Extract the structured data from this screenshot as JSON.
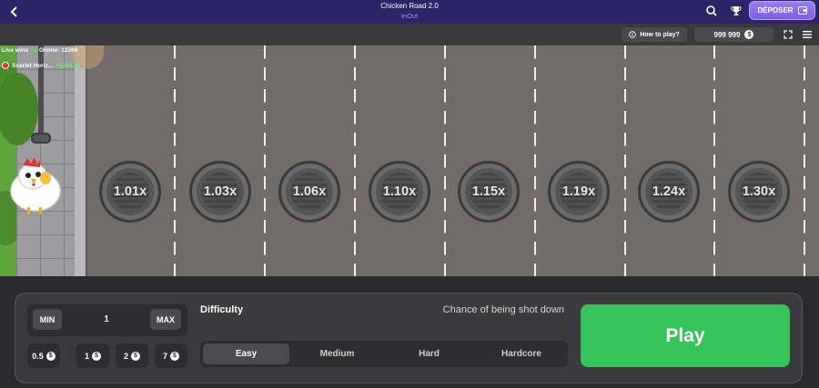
{
  "header": {
    "title": "Chicken Road 2.0",
    "subtitle": "InOut",
    "deposit_label": "DÉPOSER"
  },
  "toolbar": {
    "how_to_play": "How to play?",
    "balance": "999 999",
    "coin_symbol": "$"
  },
  "live": {
    "live_wins_label": "Live wins",
    "online_label": "Online: 12269",
    "winner_name": "Scarlet Horiz...",
    "winner_amount": "+$265.10"
  },
  "multipliers": [
    "1.01x",
    "1.03x",
    "1.06x",
    "1.10x",
    "1.15x",
    "1.19x",
    "1.24x",
    "1.30x"
  ],
  "bet": {
    "min_label": "MIN",
    "max_label": "MAX",
    "value": "1",
    "chips": [
      "0.5",
      "1",
      "2",
      "7"
    ]
  },
  "difficulty": {
    "label": "Difficulty",
    "chance_label": "Chance of being shot down",
    "options": [
      "Easy",
      "Medium",
      "Hard",
      "Hardcore"
    ],
    "selected": "Easy"
  },
  "play_label": "Play",
  "colors": {
    "header_bg": "#2c2466",
    "deposit_accent": "#8b6ff0",
    "play_green": "#36c45a",
    "road_gray": "#716c6a",
    "win_green": "#5df06a"
  },
  "icons": {
    "back": "chevron-left-icon",
    "search": "search-icon",
    "trophy": "trophy-icon",
    "wallet": "wallet-icon",
    "info": "info-icon",
    "fullscreen": "fullscreen-icon",
    "menu": "hamburger-menu-icon",
    "coin": "dollar-coin-icon"
  }
}
